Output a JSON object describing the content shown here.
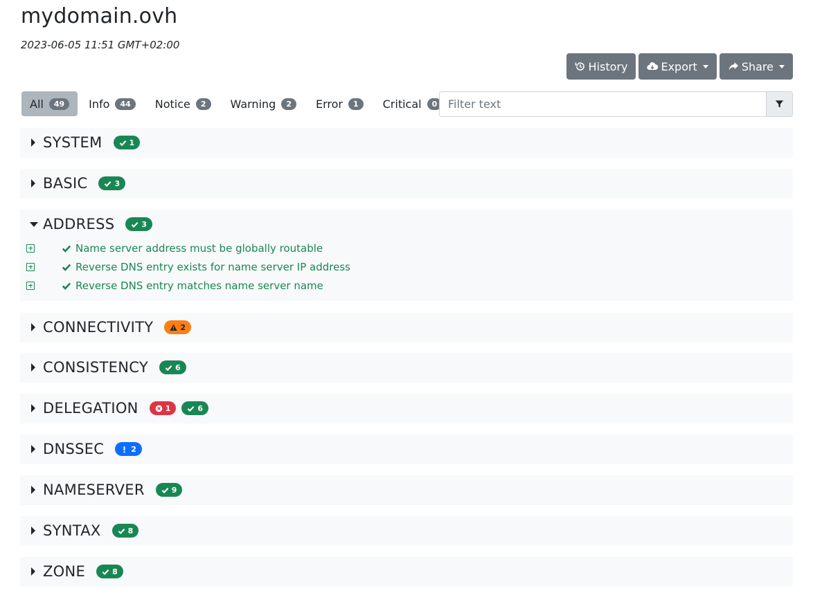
{
  "page": {
    "title": "mydomain.ovh",
    "date": "2023-06-05 11:51 GMT+02:00"
  },
  "toolbar": {
    "history_label": "History",
    "export_label": "Export",
    "share_label": "Share"
  },
  "filters": [
    {
      "label": "All",
      "count": "49",
      "active": true
    },
    {
      "label": "Info",
      "count": "44"
    },
    {
      "label": "Notice",
      "count": "2"
    },
    {
      "label": "Warning",
      "count": "2"
    },
    {
      "label": "Error",
      "count": "1"
    },
    {
      "label": "Critical",
      "count": "0"
    }
  ],
  "filter_input": {
    "placeholder": "Filter text",
    "value": ""
  },
  "sections": [
    {
      "name": "SYSTEM",
      "badges": [
        {
          "type": "ok",
          "count": "1"
        }
      ]
    },
    {
      "name": "BASIC",
      "badges": [
        {
          "type": "ok",
          "count": "3"
        }
      ]
    },
    {
      "name": "ADDRESS",
      "expanded": true,
      "badges": [
        {
          "type": "ok",
          "count": "3"
        }
      ],
      "items": [
        "Name server address must be globally routable",
        "Reverse DNS entry exists for name server IP address",
        "Reverse DNS entry matches name server name"
      ]
    },
    {
      "name": "CONNECTIVITY",
      "badges": [
        {
          "type": "warning",
          "count": "2"
        }
      ]
    },
    {
      "name": "CONSISTENCY",
      "badges": [
        {
          "type": "ok",
          "count": "6"
        }
      ]
    },
    {
      "name": "DELEGATION",
      "badges": [
        {
          "type": "error",
          "count": "1"
        },
        {
          "type": "ok",
          "count": "6"
        }
      ]
    },
    {
      "name": "DNSSEC",
      "badges": [
        {
          "type": "notice",
          "count": "2"
        }
      ]
    },
    {
      "name": "NAMESERVER",
      "badges": [
        {
          "type": "ok",
          "count": "9"
        }
      ]
    },
    {
      "name": "SYNTAX",
      "badges": [
        {
          "type": "ok",
          "count": "8"
        }
      ]
    },
    {
      "name": "ZONE",
      "badges": [
        {
          "type": "ok",
          "count": "8"
        }
      ]
    }
  ],
  "colors": {
    "ok": "#198754",
    "warning": "#fd7e14",
    "error": "#dc3545",
    "notice": "#0d6efd",
    "button": "#6c757d",
    "section_bg": "#f8f9fa"
  },
  "icons": {
    "history": "history-icon",
    "export": "cloud-download-icon",
    "share": "share-icon",
    "filter": "filter-icon",
    "ok": "check-icon",
    "warning": "warning-triangle-icon",
    "error": "x-circle-icon",
    "notice": "exclamation-icon",
    "collapsed": "caret-right-icon",
    "expanded": "caret-down-icon",
    "item_expand": "plus-square-icon"
  }
}
